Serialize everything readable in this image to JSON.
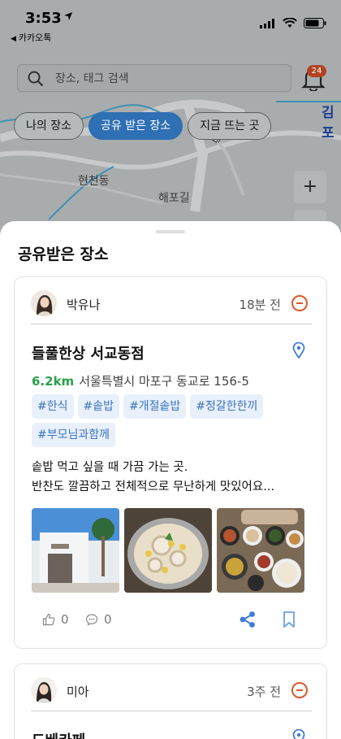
{
  "status": {
    "time": "3:53",
    "back_app": "카카오톡"
  },
  "search": {
    "placeholder": "장소, 태그 검색"
  },
  "notifications": {
    "badge": "24"
  },
  "chips": [
    {
      "label": "나의 장소"
    },
    {
      "label": "공유 받은 장소",
      "active": true
    },
    {
      "label": "지금 뜨는 곳"
    }
  ],
  "map": {
    "labels": [
      "현천동",
      "해포길",
      "덕은로",
      "김포"
    ],
    "zoom_in": "+"
  },
  "sheet": {
    "title": "공유받은 장소",
    "posts": [
      {
        "user": "박유나",
        "time": "18분 전",
        "place": "들풀한상 서교동점",
        "distance": "6.2km",
        "address": "서울특별시 마포구 동교로 156-5",
        "tags": [
          "#한식",
          "#솥밥",
          "#개절솥밥",
          "#정갈한한끼",
          "#부모님과함께"
        ],
        "desc_line1": "솥밥 먹고 싶을 때 가끔 가는 곳.",
        "desc_line2": "반찬도 깔끔하고 전체적으로 무난하게 맛있어요...",
        "likes": "0",
        "comments": "0"
      },
      {
        "user": "미아",
        "time": "3주 전",
        "place": "드베카페"
      }
    ]
  },
  "colors": {
    "accent": "#2f6fb4",
    "distance": "#2aa14a",
    "remove": "#e0572a",
    "tag_bg": "#e8f0fb",
    "tag_text": "#3d73c2"
  }
}
